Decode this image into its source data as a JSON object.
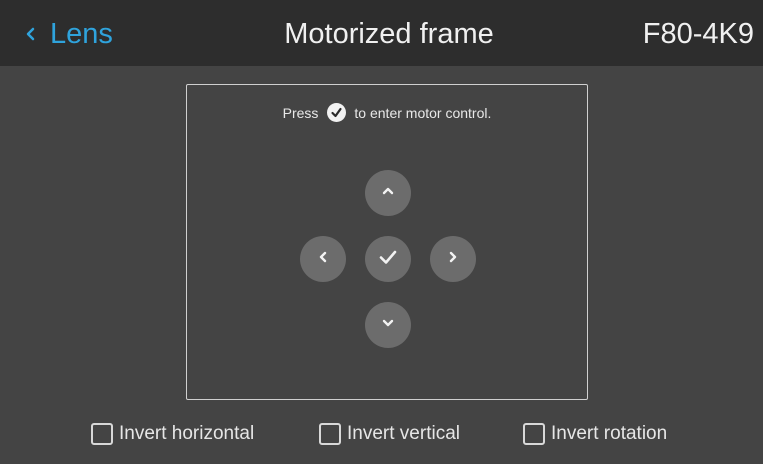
{
  "header": {
    "back_label": "Lens",
    "title": "Motorized frame",
    "model": "F80-4K9"
  },
  "panel": {
    "instruction_before": "Press",
    "instruction_after": "to enter motor control."
  },
  "options": [
    {
      "label": "Invert horizontal",
      "checked": false
    },
    {
      "label": "Invert vertical",
      "checked": false
    },
    {
      "label": "Invert rotation",
      "checked": false
    }
  ],
  "colors": {
    "accent": "#2fa3dc",
    "background": "#444444",
    "header": "#2d2d2d",
    "button": "#6c6c6c"
  },
  "icons": {
    "back": "chevron-left-icon",
    "confirm": "checkmark-icon",
    "up": "chevron-up-icon",
    "down": "chevron-down-icon",
    "left": "chevron-left-icon",
    "right": "chevron-right-icon"
  }
}
